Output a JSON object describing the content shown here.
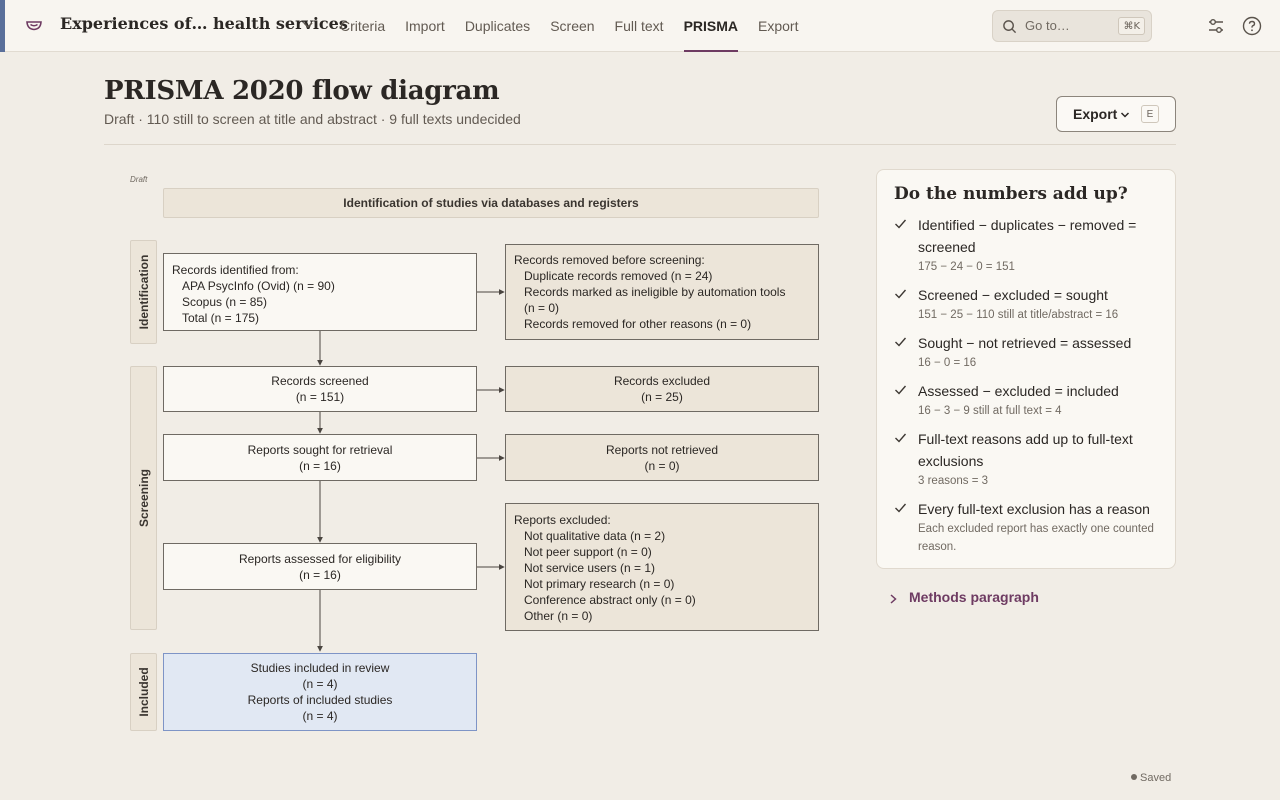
{
  "app": {
    "project_title": "Experiences of… health services",
    "nav": [
      {
        "label": "Criteria",
        "active": false
      },
      {
        "label": "Import",
        "active": false
      },
      {
        "label": "Duplicates",
        "active": false
      },
      {
        "label": "Screen",
        "active": false
      },
      {
        "label": "Full text",
        "active": false
      },
      {
        "label": "PRISMA",
        "active": true
      },
      {
        "label": "Export",
        "active": false
      }
    ],
    "goto_placeholder": "Go to…",
    "goto_shortcut": "⌘K",
    "icons": [
      "logo-icon",
      "chevron-down-icon",
      "search-icon",
      "sliders-icon",
      "help-icon"
    ],
    "accent_color": "#6e3b62"
  },
  "page": {
    "title": "PRISMA 2020 flow diagram",
    "subtitle": "Draft · 110 still to screen at title and abstract · 9 full texts undecided",
    "export_label": "Export",
    "export_shortcut": "E"
  },
  "diagram": {
    "draft_label": "Draft",
    "header": "Identification of studies via databases and registers",
    "phases": {
      "identification": "Identification",
      "screening": "Screening",
      "included": "Included"
    },
    "identified": {
      "title": "Records identified from:",
      "lines": [
        "APA PsycInfo (Ovid) (n = 90)",
        "Scopus (n = 85)",
        "Total (n = 175)"
      ]
    },
    "removed": {
      "title": "Records removed before screening:",
      "lines": [
        "Duplicate records removed (n = 24)",
        "Records marked as ineligible by automation tools",
        "(n = 0)",
        "Records removed for other reasons (n = 0)"
      ]
    },
    "screened": {
      "label": "Records screened",
      "count": "(n = 151)"
    },
    "excluded": {
      "label": "Records excluded",
      "count": "(n = 25)"
    },
    "sought": {
      "label": "Reports sought for retrieval",
      "count": "(n = 16)"
    },
    "not_retrieved": {
      "label": "Reports not retrieved",
      "count": "(n = 0)"
    },
    "assessed": {
      "label": "Reports assessed for eligibility",
      "count": "(n = 16)"
    },
    "reports_excluded": {
      "title": "Reports excluded:",
      "lines": [
        "Not qualitative data (n = 2)",
        "Not peer support (n = 0)",
        "Not service users (n = 1)",
        "Not primary research (n = 0)",
        "Conference abstract only (n = 0)",
        "Other (n = 0)"
      ]
    },
    "included": {
      "studies_label": "Studies included in review",
      "studies_count": "(n = 4)",
      "reports_label": "Reports of included studies",
      "reports_count": "(n = 4)"
    }
  },
  "checks": {
    "title": "Do the numbers add up?",
    "items": [
      {
        "main": "Identified − duplicates − removed = screened",
        "detail": "175 − 24 − 0 = 151"
      },
      {
        "main": "Screened − excluded = sought",
        "detail": "151 − 25 − 110 still at title/abstract = 16"
      },
      {
        "main": "Sought − not retrieved = assessed",
        "detail": "16 − 0 = 16"
      },
      {
        "main": "Assessed − excluded = included",
        "detail": "16 − 3 − 9 still at full text = 4"
      },
      {
        "main": "Full-text reasons add up to full-text exclusions",
        "detail": "3 reasons = 3"
      },
      {
        "main": "Every full-text exclusion has a reason",
        "detail": "Each excluded report has exactly one counted reason."
      }
    ]
  },
  "methods_label": "Methods paragraph",
  "status_saved": "Saved"
}
